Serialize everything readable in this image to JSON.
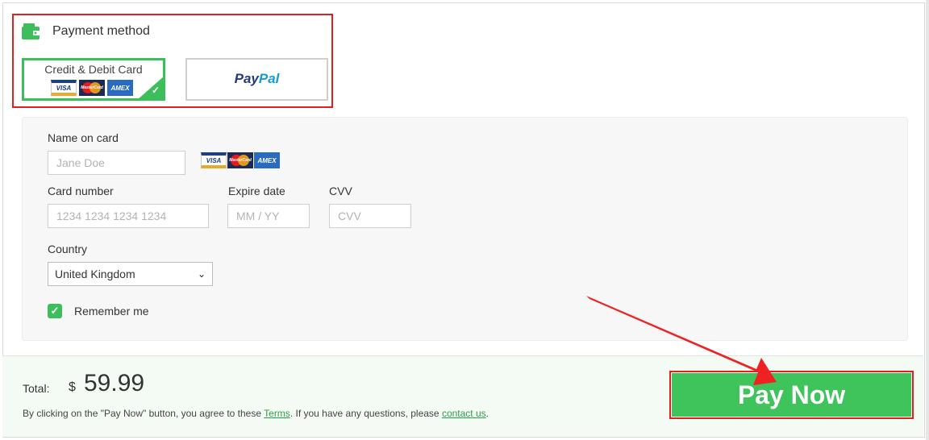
{
  "payment_method": {
    "title": "Payment method",
    "options": [
      {
        "label": "Credit & Debit Card",
        "selected": true
      },
      {
        "label_part1": "Pay",
        "label_part2": "Pal",
        "selected": false
      }
    ]
  },
  "card_logos": {
    "visa": "VISA",
    "mastercard": "MasterCard",
    "amex": "AMEX"
  },
  "form": {
    "name_label": "Name on card",
    "name_placeholder": "Jane Doe",
    "card_number_label": "Card number",
    "card_number_placeholder": "1234 1234 1234 1234",
    "expire_label": "Expire date",
    "expire_placeholder": "MM / YY",
    "cvv_label": "CVV",
    "cvv_placeholder": "CVV",
    "country_label": "Country",
    "country_value": "United Kingdom",
    "remember_label": "Remember me",
    "remember_checked": true
  },
  "footer": {
    "total_label": "Total:",
    "currency": "$",
    "amount": "59.99",
    "terms_prefix": "By clicking on the \"Pay Now\" button, you agree to these ",
    "terms_link": "Terms",
    "terms_middle": ".   If you have any questions, please ",
    "contact_link": "contact us",
    "terms_suffix": "."
  },
  "pay_button": {
    "label": "Pay Now"
  },
  "colors": {
    "accent": "#3fc35b",
    "annotation": "#e02020",
    "paypal_dark": "#253b80",
    "paypal_light": "#179bd7"
  }
}
